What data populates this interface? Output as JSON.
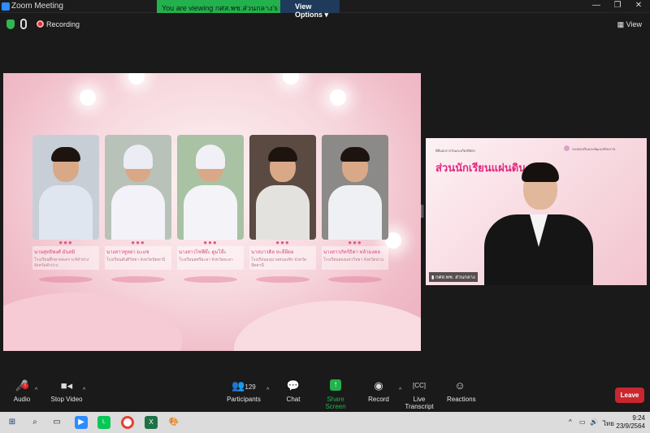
{
  "window": {
    "title": "Zoom Meeting"
  },
  "banner": {
    "viewing_text": "You are viewing กศส.พช.ส่วนกลาง's screen",
    "view_options": "View Options"
  },
  "status": {
    "recording_label": "Recording",
    "view_label": "View"
  },
  "share": {
    "cards": [
      {
        "name": "นายสุทธิพงศ์  มันสมิ",
        "school": "โรงเรียนศึกษาสงเคราะห์ลำปาง จังหวัดลำปาง"
      },
      {
        "name": "นางสาวซูหยา  มะแซ",
        "school": "โรงเรียนสันติวิทยา จังหวัดปัตตานี"
      },
      {
        "name": "นางสาวไซฟีย๊ะ  ดูมโล๊ะ",
        "school": "โรงเรียนสตรียะลา จังหวัดยะลา"
      },
      {
        "name": "นายบาวดิล  หะยียีดอ",
        "school": "โรงเรียนอนุบาลหนองจิก จังหวัดปัตตานี"
      },
      {
        "name": "นางสาวภัทร์ธิดา  หล้ามงคล",
        "school": "โรงเรียนสองแคววิทยา จังหวัดน่าน"
      }
    ]
  },
  "camera": {
    "title": "ส่วนนักเรียนแผ่นดิน",
    "subtitle": "พิธีมอบรางวัลและเกียรติบัตร",
    "org": "กองส่งเสริมและพัฒนาศักยภาพ",
    "participant_label": "กศส.พช. ส่วนกลาง"
  },
  "toolbar": {
    "audio": "Audio",
    "mic_badge": "!",
    "stop_video": "Stop Video",
    "participants": "Participants",
    "participant_count": "129",
    "chat": "Chat",
    "share_screen": "Share Screen",
    "record": "Record",
    "live_transcript": "Live Transcript",
    "reactions": "Reactions",
    "leave": "Leave"
  },
  "taskbar": {
    "lang": "ไทย",
    "time": "9:24",
    "date": "23/9/2564"
  },
  "colors": {
    "share_green": "#23b14d",
    "leave_red": "#c9262f",
    "accent_pink": "#e0287d"
  }
}
